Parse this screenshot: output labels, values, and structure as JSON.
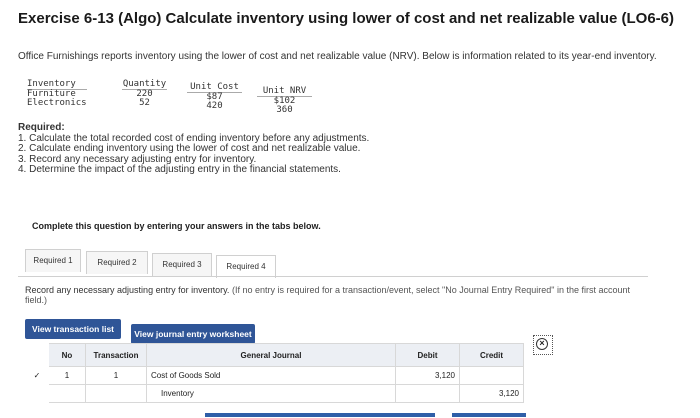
{
  "exercise": {
    "title": "Exercise 6-13 (Algo) Calculate inventory using lower of cost and net realizable value (LO6-6)",
    "intro": "Office Furnishings reports inventory using the lower of cost and net realizable value (NRV). Below is information related to its year-end inventory."
  },
  "inventory_table": {
    "headers": [
      "Inventory",
      "Quantity",
      "Unit Cost",
      "Unit NRV"
    ],
    "rows": [
      {
        "item": "Furniture",
        "quantity": "220",
        "unit_cost": "$87",
        "unit_nrv": "$102"
      },
      {
        "item": "Electronics",
        "quantity": "52",
        "unit_cost": "420",
        "unit_nrv": "360"
      }
    ]
  },
  "required": {
    "heading": "Required:",
    "items": [
      "1. Calculate the total recorded cost of ending inventory before any adjustments.",
      "2. Calculate ending inventory using the lower of cost and net realizable value.",
      "3. Record any necessary adjusting entry for inventory.",
      "4. Determine the impact of the adjusting entry in the financial statements."
    ]
  },
  "complete_text": "Complete this question by entering your answers in the tabs below.",
  "tabs": [
    "Required 1",
    "Required 2",
    "Required 3",
    "Required 4"
  ],
  "instruction": {
    "main": "Record any necessary adjusting entry for inventory.",
    "hint": "(If no entry is required for a transaction/event, select \"No Journal Entry Required\" in the first account field.)"
  },
  "buttons": {
    "view_transaction_list": "View transaction list",
    "view_journal_worksheet": "View journal entry worksheet"
  },
  "journal": {
    "headers": {
      "no": "No",
      "transaction": "Transaction",
      "general_journal": "General Journal",
      "debit": "Debit",
      "credit": "Credit"
    },
    "rows": [
      {
        "no": "1",
        "transaction": "1",
        "account": "Cost of Goods Sold",
        "debit": "3,120",
        "credit": ""
      },
      {
        "no": "",
        "transaction": "",
        "account": "Inventory",
        "debit": "",
        "credit": "3,120"
      }
    ]
  },
  "colors": {
    "accent": "#2f5597",
    "bar": "#2f5fa8"
  }
}
